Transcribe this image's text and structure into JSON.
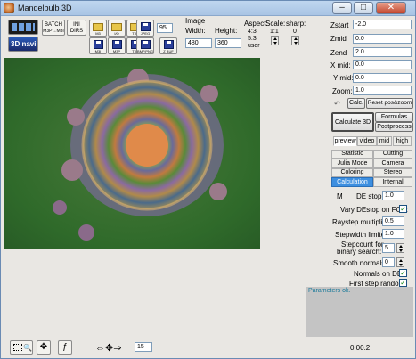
{
  "window": {
    "title": "Mandelbulb 3D"
  },
  "toolbar": {
    "batch_label": "BATCH",
    "batch_sub": "M3P→M3I",
    "ini_label": "INI",
    "ini_sub": "DIRS",
    "open_ico_label": "M3",
    "open_io_label": "I/O",
    "save_txt_label": "TXT",
    "jpeg_label": "JPEG",
    "quality": "95",
    "save_m3i_label": "M3I",
    "save_m3p_label": "M3P",
    "save_txt2_label": "TXT",
    "bmp_png_label": "BMP,PNG",
    "zbuf_label": "Z BUF",
    "navi_label": "3D navi"
  },
  "image": {
    "group_label": "Image",
    "width_label": "Width:",
    "width_value": "480",
    "height_label": "Height:",
    "height_value": "360",
    "aspect_label": "Aspect:",
    "aspect_value": "4:3",
    "aspect_value2": "5:3",
    "aspect_user": "user",
    "scale_label": "Scale:",
    "scale_value": "1:1",
    "scale_value2": "1",
    "sharp_label": "sharp:",
    "sharp_value": "0"
  },
  "right_panel": {
    "zstart_label": "Zstart",
    "zstart_value": "-2.0",
    "zmid_label": "Zmid",
    "zmid_value": "0.0",
    "zend_label": "Zend",
    "zend_value": "2.0",
    "xmid_label": "X mid:",
    "xmid_value": "0.0",
    "ymid_label": "Y mid:",
    "ymid_value": "0.0",
    "zoom_label": "Zoom:",
    "zoom_value": "1.0",
    "calc_label": "Calc.",
    "reset_label": "Reset pos&zoom",
    "calculate_label": "Calculate 3D",
    "formulas_label": "Formulas",
    "postprocess_label": "Postprocess",
    "tabs_top": [
      "preview",
      "video",
      "mid",
      "high"
    ],
    "tabs_grid": [
      "Statistic",
      "Cutting",
      "Julia Mode",
      "Camera",
      "Coloring",
      "Stereo",
      "Calculation",
      "Internal"
    ],
    "m_label": "M",
    "de_stop_label": "DE stop:",
    "de_stop_value": "1.0",
    "vary_destop_label": "Vary DEstop on FOV:",
    "raystep_label": "Raystep multiplier:",
    "raystep_value": "0.5",
    "stepwidth_label": "Stepwidth limiter:",
    "stepwidth_value": "1.0",
    "stepcount_label1": "Stepcount for",
    "stepcount_label2": "binary search:",
    "stepcount_value": "5",
    "smooth_label": "Smooth  normals:",
    "smooth_value": "0",
    "normals_de_label": "Normals on DE:",
    "first_step_label": "First step random:",
    "check_mark": "✓",
    "status_message": "Parameters ok."
  },
  "bottom": {
    "nav_step_value": "15",
    "time_value": "0:00.2"
  },
  "colors": {
    "accent": "#3d8fe0",
    "fractal_bg": "#2f6a2a"
  }
}
